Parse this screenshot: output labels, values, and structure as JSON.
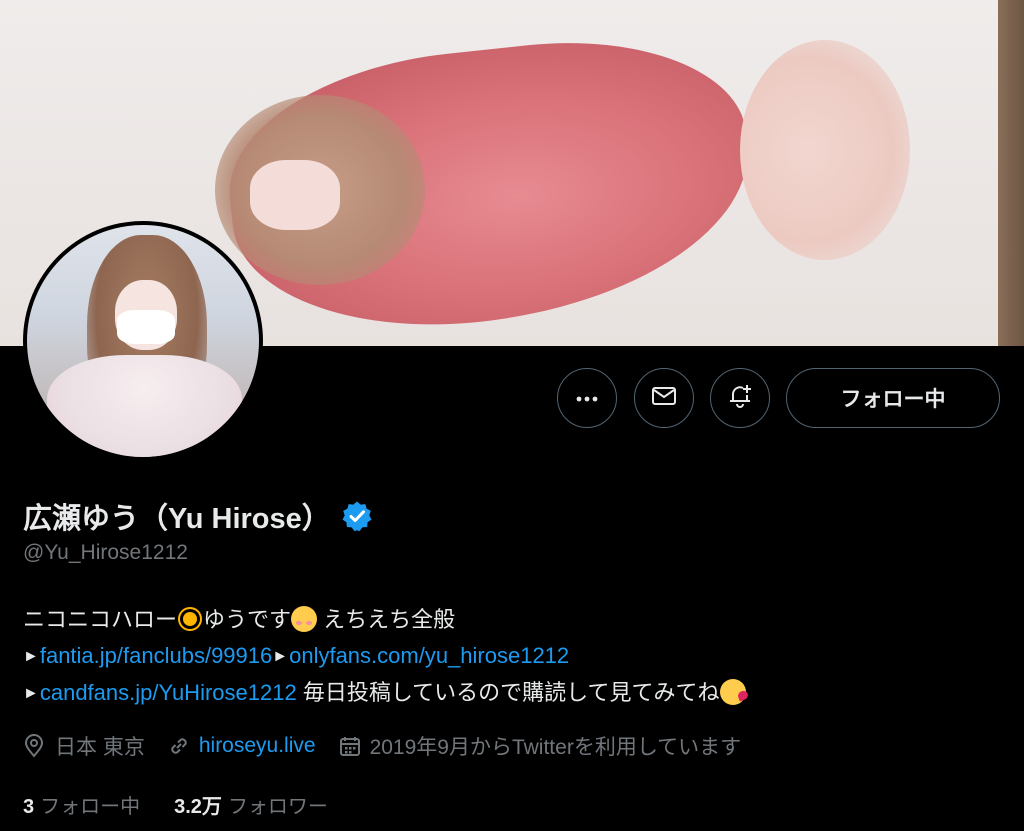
{
  "profile": {
    "display_name": "広瀬ゆう（Yu Hirose）",
    "handle": "@Yu_Hirose1212",
    "verified": true
  },
  "actions": {
    "more_icon": "more-horizontal-icon",
    "message_icon": "envelope-icon",
    "notify_icon": "bell-plus-icon",
    "follow_label": "フォロー中"
  },
  "bio": {
    "line1_part1": "ニコニコハロー",
    "line1_part2": "ゆうです",
    "line1_part3": " えちえち全般",
    "link1": "fantia.jp/fanclubs/99916",
    "link2": "onlyfans.com/yu_hirose1212",
    "link3": "candfans.jp/YuHirose1212",
    "line3_text": " 毎日投稿しているので購読して見てみてね",
    "arrow": "►"
  },
  "meta": {
    "location": "日本 東京",
    "website": "hiroseyu.live",
    "joined": "2019年9月からTwitterを利用しています"
  },
  "stats": {
    "following_count": "3",
    "following_label": "フォロー中",
    "followers_count": "3.2万",
    "followers_label": "フォロワー"
  },
  "colors": {
    "link": "#1d9bf0",
    "verified": "#1d9bf0",
    "secondary_text": "#71767b",
    "background": "#000000"
  }
}
